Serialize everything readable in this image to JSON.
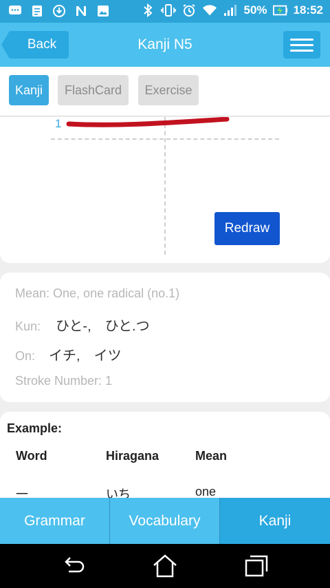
{
  "status_bar": {
    "battery": "50%",
    "time": "18:52",
    "icons_left": [
      "message-icon",
      "notes-icon",
      "download-icon",
      "n-icon",
      "image-icon"
    ],
    "icons_right": [
      "bluetooth-icon",
      "vibrate-icon",
      "alarm-icon",
      "wifi-icon",
      "signal-icon",
      "battery-icon"
    ]
  },
  "header": {
    "back_label": "Back",
    "title": "Kanji N5"
  },
  "tabs": [
    {
      "label": "Kanji",
      "active": true
    },
    {
      "label": "FlashCard",
      "active": false
    },
    {
      "label": "Exercise",
      "active": false
    }
  ],
  "drawing": {
    "stroke_order_label": "1",
    "redraw_label": "Redraw"
  },
  "info": {
    "mean": "Mean: One, one radical (no.1)",
    "kun_label": "Kun:",
    "kun_value": "ひと-,　ひと.つ",
    "on_label": "On:",
    "on_value": "イチ,　イツ",
    "stroke_number": "Stroke Number: 1"
  },
  "example": {
    "title": "Example:",
    "columns": [
      "Word",
      "Hiragana",
      "Mean"
    ],
    "rows": [
      {
        "word": "一",
        "hiragana": "いち",
        "mean": "one"
      }
    ]
  },
  "bottom_nav": [
    {
      "label": "Grammar",
      "active": false
    },
    {
      "label": "Vocabulary",
      "active": false
    },
    {
      "label": "Kanji",
      "active": true
    }
  ],
  "colors": {
    "header": "#4cc0ee",
    "accent": "#2aa8e0",
    "redraw": "#1256cf",
    "stroke": "#c2121f"
  }
}
